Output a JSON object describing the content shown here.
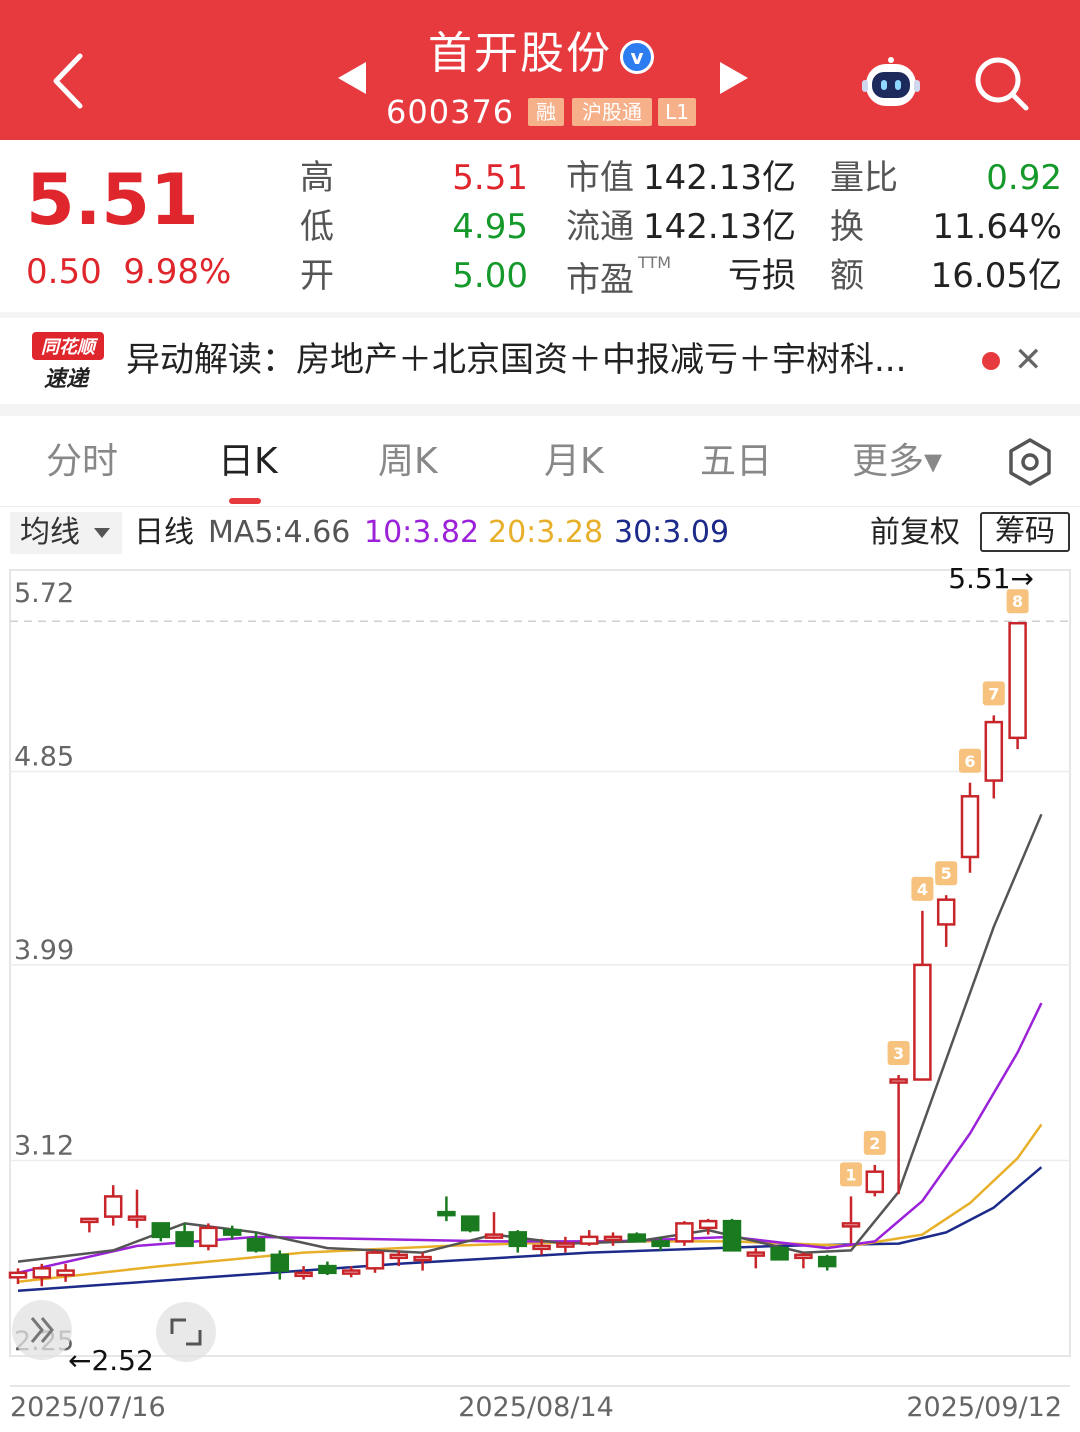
{
  "header": {
    "stock_name": "首开股份",
    "stock_code": "600376",
    "tags": [
      "融",
      "沪股通",
      "L1"
    ],
    "bg_color": "#e73a3f"
  },
  "quote": {
    "price": "5.51",
    "change": "0.50",
    "change_pct": "9.98%",
    "high_label": "高",
    "high": "5.51",
    "low_label": "低",
    "low": "4.95",
    "open_label": "开",
    "open": "5.00",
    "mcap_label": "市值",
    "mcap": "142.13亿",
    "float_label": "流通",
    "float": "142.13亿",
    "pe_label": "市盈",
    "pe_sup": "TTM",
    "pe": "亏损",
    "vr_label": "量比",
    "vr": "0.92",
    "turnover_label": "换",
    "turnover": "11.64%",
    "amount_label": "额",
    "amount": "16.05亿"
  },
  "news": {
    "logo_top": "同花顺",
    "logo_bottom": "速递",
    "text": "异动解读：房地产＋北京国资＋中报减亏＋宇树科..."
  },
  "tabs": [
    {
      "label": "分时"
    },
    {
      "label": "日K"
    },
    {
      "label": "周K"
    },
    {
      "label": "月K"
    },
    {
      "label": "五日"
    },
    {
      "label": "更多▾"
    }
  ],
  "ma_bar": {
    "select_label": "均线",
    "period": "日线",
    "ma5": "MA5:4.66",
    "ma10": "10:3.82",
    "ma20": "20:3.28",
    "ma30": "30:3.09",
    "adjust": "前复权",
    "chips": "筹码",
    "colors": {
      "ma5": "#555555",
      "ma10": "#9b22d8",
      "ma20": "#e8b02a",
      "ma30": "#1c2a8a"
    }
  },
  "chart_data": {
    "type": "candlestick",
    "y_ticks": [
      "5.72",
      "4.85",
      "3.99",
      "3.12",
      "2.25"
    ],
    "ylim": [
      2.25,
      5.72
    ],
    "x_labels": [
      "2025/07/16",
      "2025/08/14",
      "2025/09/12"
    ],
    "high_marker": "5.51→",
    "low_marker": "←2.52",
    "up_color": "#c8252b",
    "down_color": "#1a7a1f",
    "candles": [
      {
        "o": 2.6,
        "h": 2.64,
        "l": 2.57,
        "c": 2.62
      },
      {
        "o": 2.6,
        "h": 2.66,
        "l": 2.56,
        "c": 2.64
      },
      {
        "o": 2.61,
        "h": 2.66,
        "l": 2.58,
        "c": 2.63
      },
      {
        "o": 2.85,
        "h": 2.86,
        "l": 2.8,
        "c": 2.86
      },
      {
        "o": 2.87,
        "h": 3.01,
        "l": 2.83,
        "c": 2.96
      },
      {
        "o": 2.87,
        "h": 2.99,
        "l": 2.82,
        "c": 2.87
      },
      {
        "o": 2.84,
        "h": 2.84,
        "l": 2.76,
        "c": 2.78
      },
      {
        "o": 2.8,
        "h": 2.84,
        "l": 2.74,
        "c": 2.74
      },
      {
        "o": 2.74,
        "h": 2.84,
        "l": 2.72,
        "c": 2.82
      },
      {
        "o": 2.81,
        "h": 2.83,
        "l": 2.77,
        "c": 2.79
      },
      {
        "o": 2.77,
        "h": 2.8,
        "l": 2.71,
        "c": 2.72
      },
      {
        "o": 2.7,
        "h": 2.72,
        "l": 2.59,
        "c": 2.63
      },
      {
        "o": 2.62,
        "h": 2.65,
        "l": 2.59,
        "c": 2.62
      },
      {
        "o": 2.65,
        "h": 2.67,
        "l": 2.61,
        "c": 2.62
      },
      {
        "o": 2.62,
        "h": 2.65,
        "l": 2.6,
        "c": 2.63
      },
      {
        "o": 2.64,
        "h": 2.72,
        "l": 2.62,
        "c": 2.71
      },
      {
        "o": 2.69,
        "h": 2.72,
        "l": 2.65,
        "c": 2.7
      },
      {
        "o": 2.68,
        "h": 2.71,
        "l": 2.63,
        "c": 2.69
      },
      {
        "o": 2.89,
        "h": 2.96,
        "l": 2.85,
        "c": 2.88
      },
      {
        "o": 2.87,
        "h": 2.87,
        "l": 2.8,
        "c": 2.81
      },
      {
        "o": 2.79,
        "h": 2.89,
        "l": 2.77,
        "c": 2.79
      },
      {
        "o": 2.8,
        "h": 2.81,
        "l": 2.71,
        "c": 2.74
      },
      {
        "o": 2.73,
        "h": 2.77,
        "l": 2.7,
        "c": 2.74
      },
      {
        "o": 2.74,
        "h": 2.78,
        "l": 2.71,
        "c": 2.75
      },
      {
        "o": 2.75,
        "h": 2.81,
        "l": 2.74,
        "c": 2.78
      },
      {
        "o": 2.77,
        "h": 2.8,
        "l": 2.74,
        "c": 2.78
      },
      {
        "o": 2.79,
        "h": 2.8,
        "l": 2.76,
        "c": 2.76
      },
      {
        "o": 2.76,
        "h": 2.78,
        "l": 2.72,
        "c": 2.74
      },
      {
        "o": 2.76,
        "h": 2.85,
        "l": 2.74,
        "c": 2.84
      },
      {
        "o": 2.82,
        "h": 2.86,
        "l": 2.79,
        "c": 2.85
      },
      {
        "o": 2.85,
        "h": 2.86,
        "l": 2.72,
        "c": 2.72
      },
      {
        "o": 2.71,
        "h": 2.73,
        "l": 2.64,
        "c": 2.71
      },
      {
        "o": 2.73,
        "h": 2.74,
        "l": 2.68,
        "c": 2.68
      },
      {
        "o": 2.7,
        "h": 2.71,
        "l": 2.64,
        "c": 2.7
      },
      {
        "o": 2.69,
        "h": 2.7,
        "l": 2.63,
        "c": 2.65
      },
      {
        "o": 2.84,
        "h": 2.96,
        "l": 2.75,
        "c": 2.84
      },
      {
        "o": 2.98,
        "h": 3.1,
        "l": 2.96,
        "c": 3.07
      },
      {
        "o": 3.48,
        "h": 3.5,
        "l": 2.97,
        "c": 3.48
      },
      {
        "o": 3.48,
        "h": 4.23,
        "l": 3.48,
        "c": 3.99
      },
      {
        "o": 4.17,
        "h": 4.3,
        "l": 4.07,
        "c": 4.28
      },
      {
        "o": 4.47,
        "h": 4.8,
        "l": 4.4,
        "c": 4.74
      },
      {
        "o": 4.81,
        "h": 5.1,
        "l": 4.73,
        "c": 5.07
      },
      {
        "o": 5.0,
        "h": 5.51,
        "l": 4.95,
        "c": 5.51
      }
    ],
    "limit_up_counts": [
      "1",
      "2",
      "3",
      "4",
      "5",
      "6",
      "7",
      "8"
    ],
    "ma5": [
      [
        0,
        2.67
      ],
      [
        4,
        2.72
      ],
      [
        7,
        2.84
      ],
      [
        10,
        2.8
      ],
      [
        13,
        2.73
      ],
      [
        17,
        2.71
      ],
      [
        20,
        2.79
      ],
      [
        23,
        2.75
      ],
      [
        26,
        2.76
      ],
      [
        29,
        2.81
      ],
      [
        33,
        2.71
      ],
      [
        35,
        2.72
      ],
      [
        37,
        2.98
      ],
      [
        39,
        3.57
      ],
      [
        41,
        4.16
      ],
      [
        43,
        4.66
      ]
    ],
    "ma10": [
      [
        0,
        2.62
      ],
      [
        5,
        2.74
      ],
      [
        10,
        2.78
      ],
      [
        15,
        2.77
      ],
      [
        20,
        2.76
      ],
      [
        25,
        2.76
      ],
      [
        30,
        2.78
      ],
      [
        34,
        2.73
      ],
      [
        36,
        2.76
      ],
      [
        38,
        2.94
      ],
      [
        40,
        3.24
      ],
      [
        42,
        3.6
      ],
      [
        43,
        3.82
      ]
    ],
    "ma20": [
      [
        0,
        2.58
      ],
      [
        6,
        2.65
      ],
      [
        12,
        2.71
      ],
      [
        18,
        2.74
      ],
      [
        24,
        2.76
      ],
      [
        30,
        2.76
      ],
      [
        35,
        2.74
      ],
      [
        38,
        2.79
      ],
      [
        40,
        2.93
      ],
      [
        42,
        3.13
      ],
      [
        43,
        3.28
      ]
    ],
    "ma30": [
      [
        0,
        2.54
      ],
      [
        8,
        2.6
      ],
      [
        16,
        2.66
      ],
      [
        24,
        2.71
      ],
      [
        32,
        2.74
      ],
      [
        37,
        2.75
      ],
      [
        39,
        2.8
      ],
      [
        41,
        2.91
      ],
      [
        43,
        3.09
      ]
    ]
  }
}
